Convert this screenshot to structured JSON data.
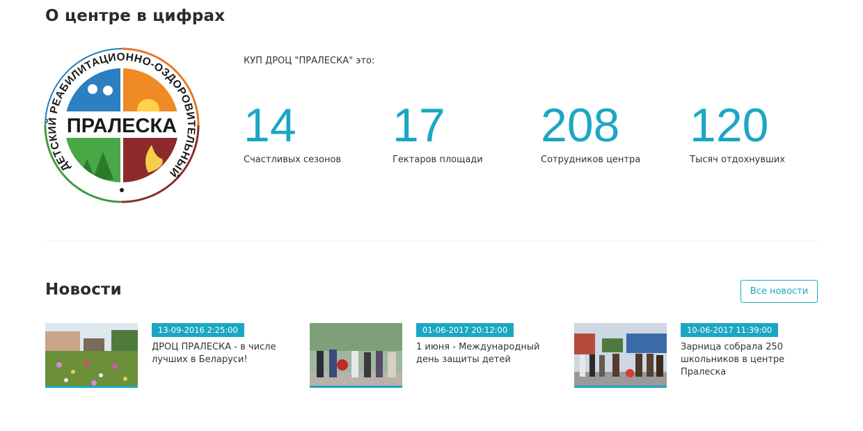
{
  "sections": {
    "stats_title": "О центре в цифрах",
    "news_title": "Новости"
  },
  "logo": {
    "main_text": "ПРАЛЕСКА",
    "ring_text": "ДЕТСКИЙ РЕАБИЛИТАЦИОННО-ОЗДОРОВИТЕЛЬНЫЙ"
  },
  "intro": "КУП ДРОЦ \"ПРАЛЕСКА\" это:",
  "stats": [
    {
      "value": "14",
      "label": "Счастливых сезонов"
    },
    {
      "value": "17",
      "label": "Гектаров площади"
    },
    {
      "value": "208",
      "label": "Сотрудников центра"
    },
    {
      "value": "120",
      "label": "Тысяч отдохнувших"
    }
  ],
  "news": {
    "all_button": "Все новости",
    "items": [
      {
        "date": "13-09-2016 2:25:00",
        "title": "ДРОЦ ПРАЛЕСКА - в числе лучших в Беларуси!"
      },
      {
        "date": "01-06-2017 20:12:00",
        "title": "1 июня - Международный день защиты детей"
      },
      {
        "date": "10-06-2017 11:39:00",
        "title": "Зарница собрала 250 школьников в центре Пралеска"
      }
    ]
  },
  "colors": {
    "accent": "#1ba7c4"
  }
}
